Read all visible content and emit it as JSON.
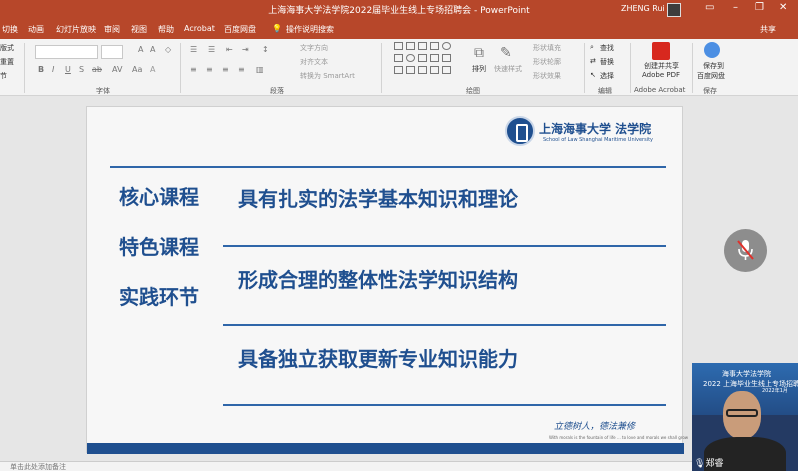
{
  "app": {
    "doc_title": "上海海事大学法学院2022届毕业生线上专场招聘会 - PowerPoint",
    "user": "ZHENG Rui"
  },
  "menu": {
    "tabs": [
      "切换",
      "动画",
      "幻灯片放映",
      "审阅",
      "视图",
      "帮助",
      "Acrobat",
      "百度网盘"
    ],
    "tellme": "操作说明搜索",
    "share": "共享"
  },
  "ribbon": {
    "groups": {
      "font": "字体",
      "paragraph": "段落",
      "drawing": "绘图",
      "editing": "编辑",
      "acrobat": "Adobe Acrobat",
      "save": "保存"
    },
    "slide_cmds": [
      "版式",
      "重置",
      "节"
    ],
    "para_cmds": [
      "文字方向",
      "对齐文本",
      "转换为 SmartArt"
    ],
    "draw_cmds": [
      "排列",
      "快速样式"
    ],
    "shape_cmds": [
      "形状填充",
      "形状轮廓",
      "形状效果"
    ],
    "edit_cmds": [
      "查找",
      "替换",
      "选择"
    ],
    "acrobat_cmd": [
      "创建并共享",
      "Adobe PDF"
    ],
    "save_cmd": [
      "保存到",
      "百度网盘"
    ]
  },
  "slide": {
    "logo_cn": "上海海事大学 法学院",
    "logo_en": "School of Law Shanghai Maritime University",
    "left_labels": [
      "核心课程",
      "特色课程",
      "实践环节"
    ],
    "points": [
      "具有扎实的法学基本知识和理论",
      "形成合理的整体性法学知识结构",
      "具备独立获取更新专业知识能力"
    ],
    "motto": "立德树人，德法兼修",
    "motto_en": "With morals is the fountain of life ... to love and morals we shall grow"
  },
  "video": {
    "banner_line1": "海事大学法学院",
    "banner_line2": "2022 上海毕业生线上专场招聘会",
    "banner_line3": "2022年1月",
    "name": "郑睿"
  },
  "notes": {
    "placeholder": "单击此处添加备注"
  },
  "colors": {
    "accent": "#b7472a",
    "slide_blue": "#1f4f8f"
  }
}
